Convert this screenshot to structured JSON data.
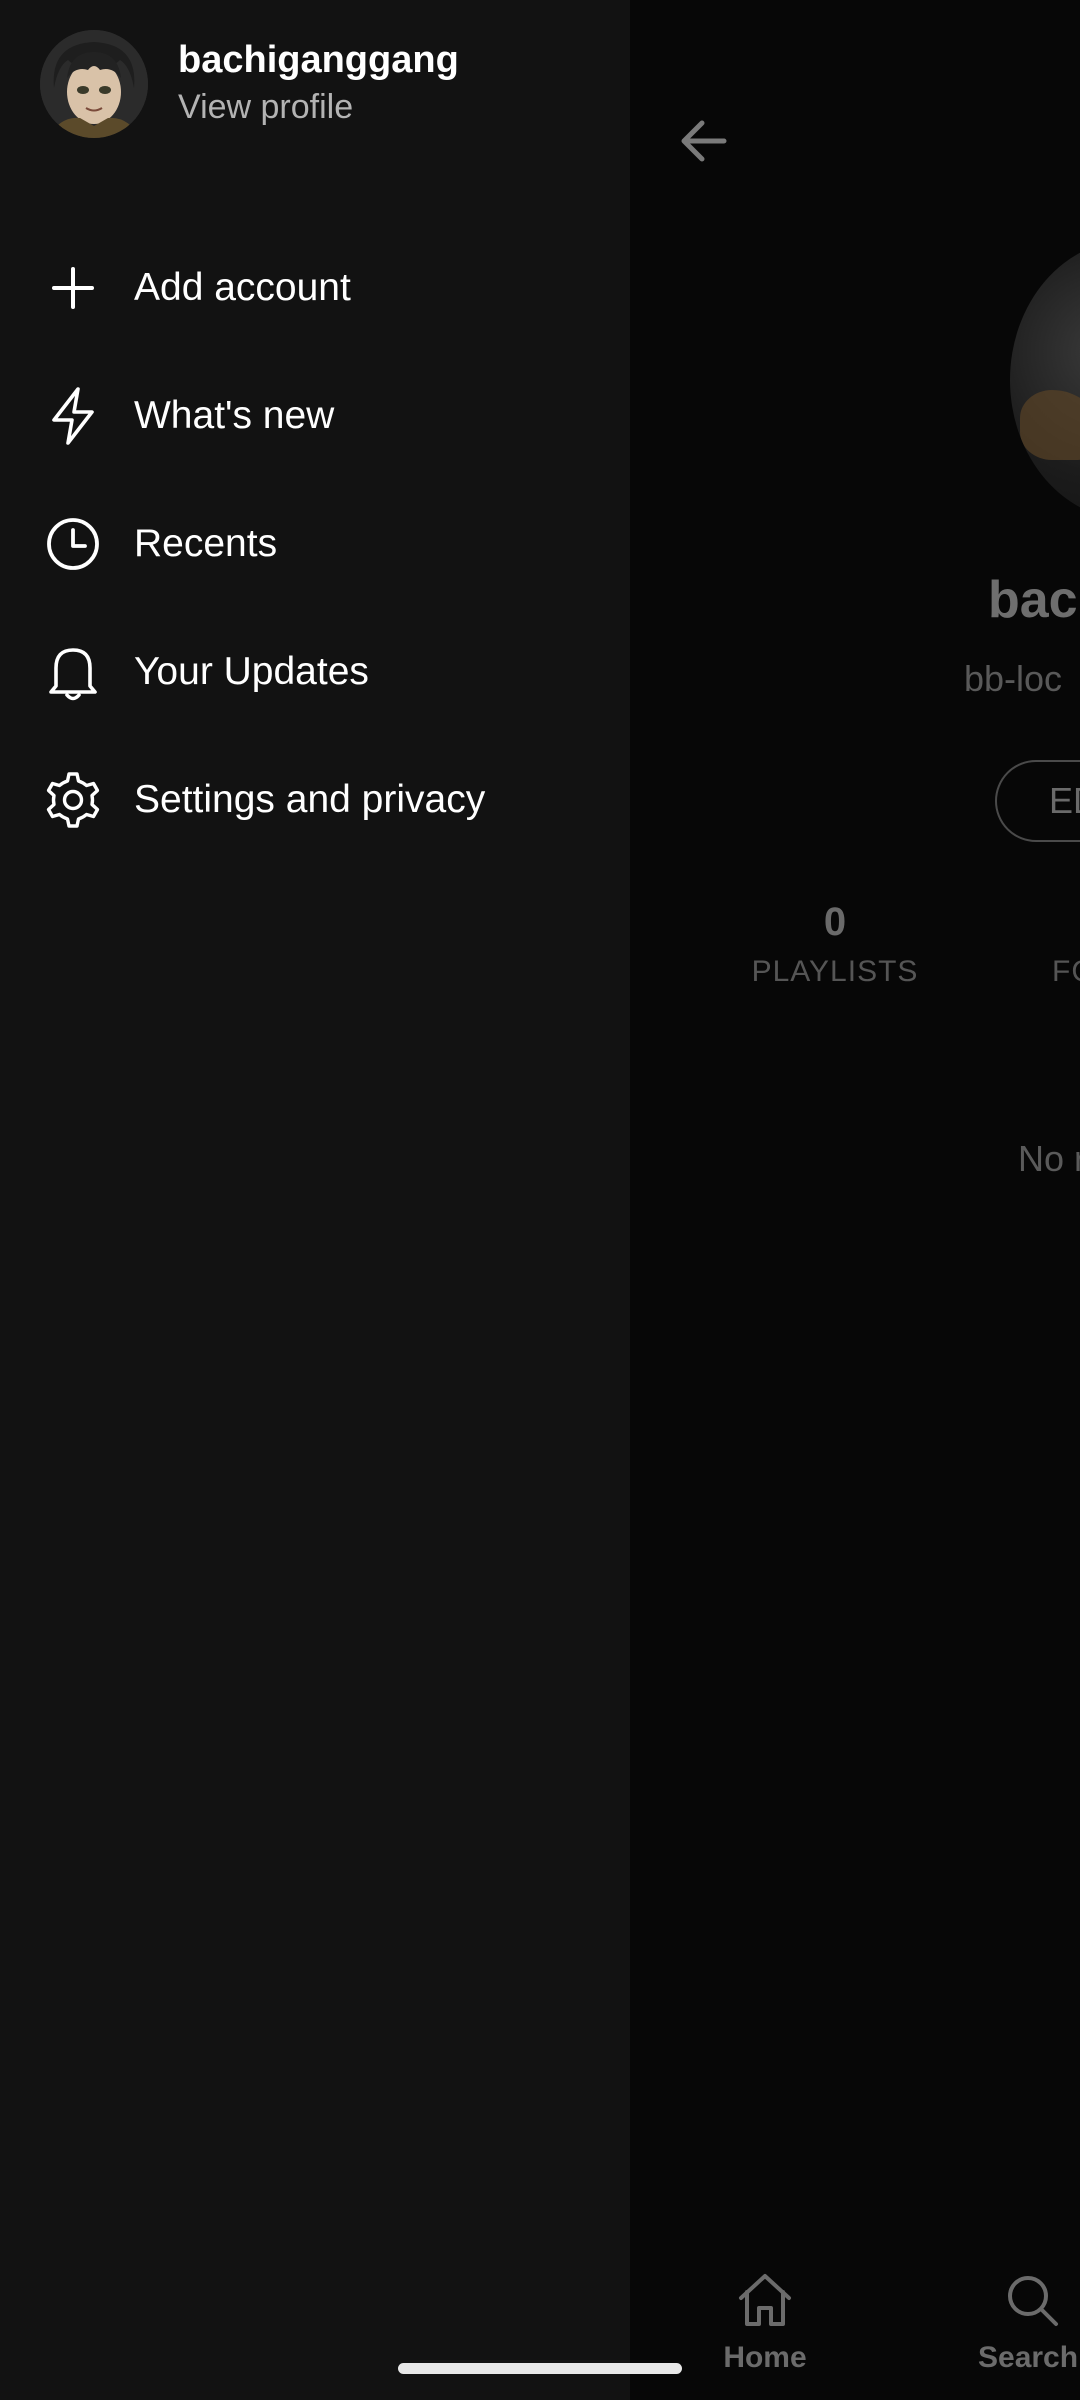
{
  "drawer": {
    "username": "bachiganggang",
    "view_profile": "View profile",
    "items": [
      {
        "label": "Add account",
        "icon": "plus-icon"
      },
      {
        "label": "What's new",
        "icon": "lightning-icon"
      },
      {
        "label": "Recents",
        "icon": "clock-icon"
      },
      {
        "label": "Your Updates",
        "icon": "bell-icon"
      },
      {
        "label": "Settings and privacy",
        "icon": "gear-icon"
      }
    ]
  },
  "background": {
    "profile_name": "bacl",
    "profile_handle": "bb-loc",
    "edit_button": "ED",
    "stats": [
      {
        "value": "0",
        "label": "PLAYLISTS"
      },
      {
        "value": "",
        "label": "FC"
      }
    ],
    "empty_text": "No r",
    "nav": {
      "home": "Home",
      "search": "Search"
    }
  },
  "colors": {
    "drawer_bg": "#121212",
    "page_bg": "#070707",
    "text_primary": "#ffffff",
    "text_secondary": "#b3b3b3"
  }
}
